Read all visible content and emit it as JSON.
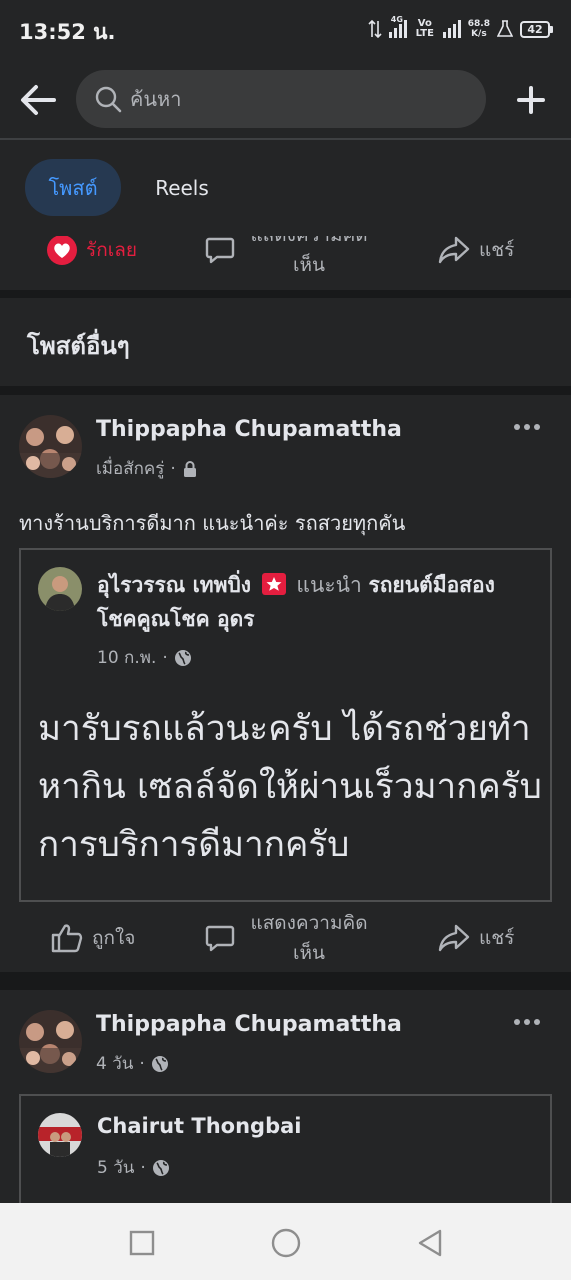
{
  "status_bar": {
    "time": "13:52 น.",
    "network_4g": "4G",
    "volte": "Vo LTE",
    "net_speed_value": "68.8",
    "net_speed_unit": "K/s",
    "battery": "42"
  },
  "top_bar": {
    "search_placeholder": "ค้นหา"
  },
  "tabs": [
    {
      "label": "โพสต์",
      "active": true
    },
    {
      "label": "Reels",
      "active": false
    }
  ],
  "partial_actions": {
    "love_label": "รักเลย",
    "comment_label": "แสดงความคิดเห็น",
    "share_label": "แชร์"
  },
  "section": {
    "title": "โพสต์อื่นๆ"
  },
  "post1": {
    "author": "Thippapha Chupamattha",
    "time": "เมื่อสักครู่",
    "text": "ทางร้านบริการดีมาก แนะนำค่ะ รถสวยทุกคัน",
    "shared": {
      "author": "อุไรวรรณ เทพบิ่ง",
      "recommend_label": "แนะนำ",
      "page_name": "รถยนต์มือสอง โชคคูณโชค อุดร",
      "date": "10 ก.พ.",
      "body": "มารับรถแล้วนะครับ ได้รถช่วยทำหากิน เซลล์จัดให้ผ่านเร็วมากครับ การบริการดีมากครับ"
    },
    "actions": {
      "like_label": "ถูกใจ",
      "comment_label": "แสดงความคิดเห็น",
      "share_label": "แชร์"
    }
  },
  "post2": {
    "author": "Thippapha Chupamattha",
    "time": "4 วัน",
    "shared": {
      "author": "Chairut Thongbai",
      "date": "5 วัน"
    }
  },
  "colors": {
    "background": "#18191a",
    "surface": "#242526",
    "accent": "#4599ff",
    "love_red": "#e41e3f"
  }
}
